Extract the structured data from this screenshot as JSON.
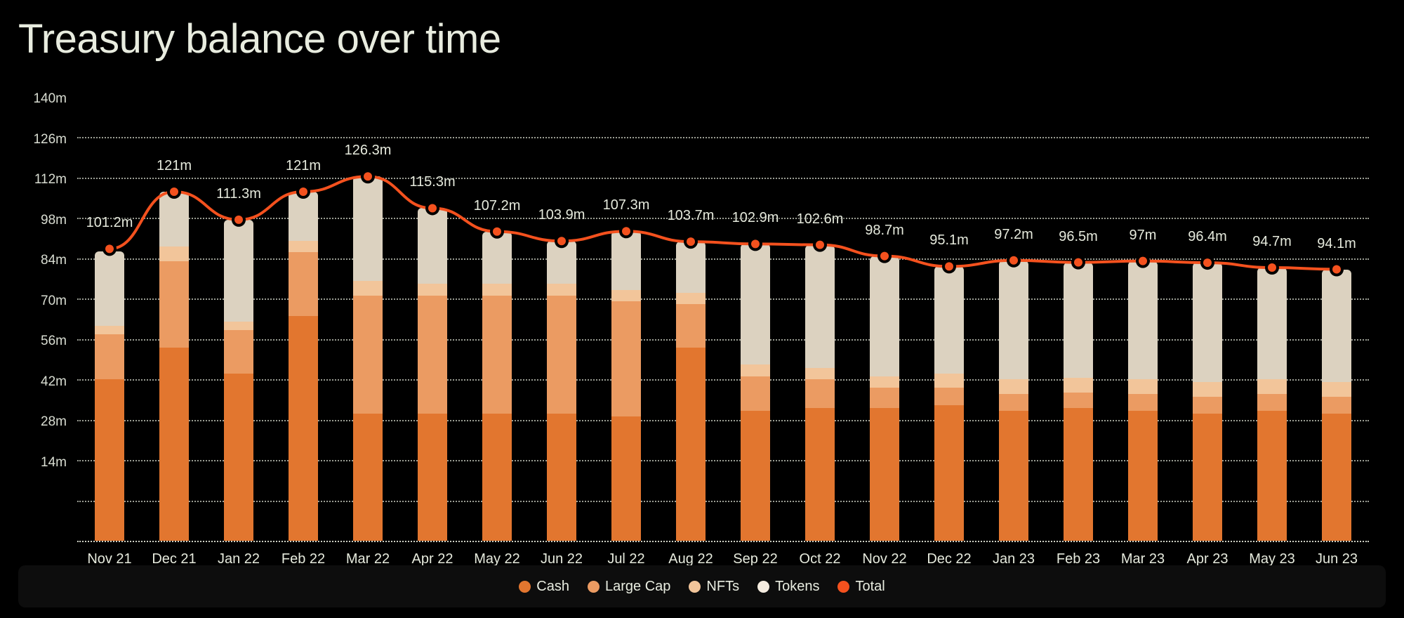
{
  "header": {
    "title": "Treasury balance over time"
  },
  "legend": {
    "position": "bottom-center",
    "items": [
      {
        "label": "Cash",
        "color": "#e2762f",
        "icon": "legend-dot-icon"
      },
      {
        "label": "Large Cap",
        "color": "#eb9b62",
        "icon": "legend-dot-icon"
      },
      {
        "label": "NFTs",
        "color": "#f2c59a",
        "icon": "legend-dot-icon"
      },
      {
        "label": "Tokens",
        "color": "#f5ece0",
        "icon": "legend-dot-icon"
      },
      {
        "label": "Total",
        "color": "#f4511e",
        "icon": "legend-dot-icon"
      }
    ]
  },
  "colors": {
    "background": "#000000",
    "panel": "#0d0d0d",
    "text": "#e6eadd",
    "grid": "#cfd3c6",
    "cash": "#e2762f",
    "large_cap": "#eb9b62",
    "nfts": "#f2c59a",
    "tokens": "#dcd2c0",
    "total_line": "#f4511e"
  },
  "chart_data": {
    "type": "bar",
    "title": "Treasury balance over time",
    "xlabel": "",
    "ylabel": "",
    "ylim": [
      0,
      140
    ],
    "grid": true,
    "yticks": [
      140,
      126,
      112,
      98,
      84,
      70,
      56,
      42,
      28,
      14
    ],
    "ytick_labels": [
      "140m",
      "126m",
      "112m",
      "98m",
      "84m",
      "70m",
      "56m",
      "42m",
      "28m",
      "14m"
    ],
    "categories": [
      "Nov 21",
      "Dec 21",
      "Jan 22",
      "Feb 22",
      "Mar 22",
      "Apr 22",
      "May 22",
      "Jun 22",
      "Jul 22",
      "Aug 22",
      "Sep 22",
      "Oct 22",
      "Nov 22",
      "Dec 22",
      "Jan 23",
      "Feb 23",
      "Mar 23",
      "Apr 23",
      "May 23",
      "Jun 23"
    ],
    "stacked": true,
    "series": [
      {
        "name": "Cash",
        "color": "#e2762f",
        "values": [
          56.0,
          67.0,
          58.0,
          78.0,
          44.0,
          44.0,
          44.0,
          44.0,
          43.0,
          67.0,
          45.0,
          46.0,
          46.0,
          47.0,
          45.0,
          46.0,
          45.0,
          44.0,
          45.0,
          44.0
        ]
      },
      {
        "name": "Large Cap",
        "color": "#eb9b62",
        "values": [
          15.5,
          30.0,
          15.0,
          22.0,
          41.0,
          41.0,
          41.0,
          41.0,
          40.0,
          15.0,
          12.0,
          10.0,
          7.0,
          6.0,
          6.0,
          5.5,
          6.0,
          6.0,
          6.0,
          6.0
        ]
      },
      {
        "name": "NFTs",
        "color": "#f2c59a",
        "values": [
          3.0,
          5.0,
          3.0,
          4.0,
          5.0,
          4.0,
          4.0,
          4.0,
          4.0,
          4.0,
          4.0,
          4.0,
          4.0,
          5.0,
          5.0,
          5.0,
          5.0,
          5.0,
          5.0,
          5.0
        ]
      },
      {
        "name": "Tokens",
        "color": "#dcd2c0",
        "values": [
          25.7,
          19.0,
          35.3,
          17.0,
          36.3,
          26.3,
          18.2,
          14.9,
          20.3,
          17.7,
          41.9,
          42.6,
          41.7,
          37.1,
          41.2,
          40.0,
          41.0,
          41.4,
          38.7,
          39.1
        ]
      }
    ],
    "total_line": {
      "name": "Total",
      "color": "#f4511e",
      "values": [
        101.2,
        121.0,
        111.3,
        121.0,
        126.3,
        115.3,
        107.2,
        103.9,
        107.3,
        103.7,
        102.9,
        102.6,
        98.7,
        95.1,
        97.2,
        96.5,
        97.0,
        96.4,
        94.7,
        94.1
      ],
      "labels": [
        "101.2m",
        "121m",
        "111.3m",
        "121m",
        "126.3m",
        "115.3m",
        "107.2m",
        "103.9m",
        "107.3m",
        "103.7m",
        "102.9m",
        "102.6m",
        "98.7m",
        "95.1m",
        "97.2m",
        "96.5m",
        "97m",
        "96.4m",
        "94.7m",
        "94.1m"
      ]
    }
  }
}
